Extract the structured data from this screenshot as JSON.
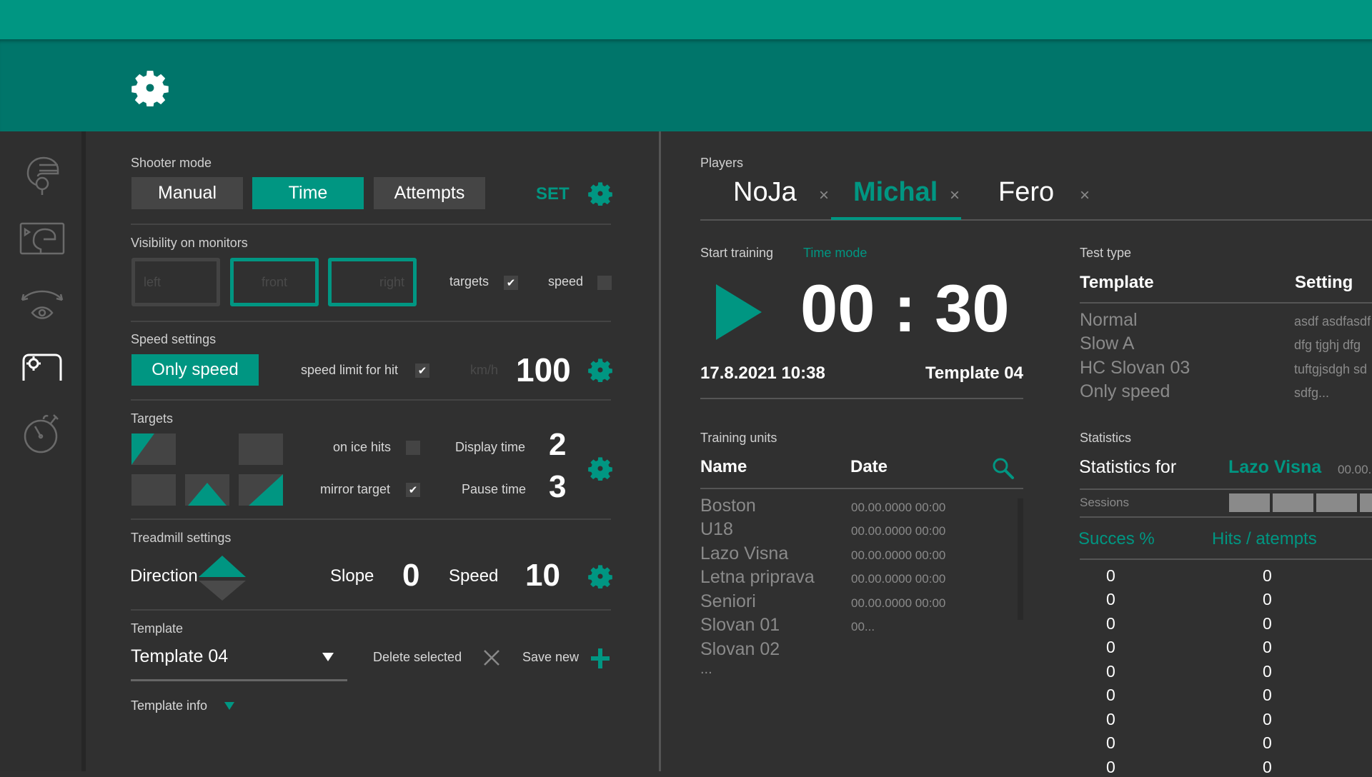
{
  "colors": {
    "accent": "#009682",
    "header": "#00756a",
    "background": "#303030",
    "muted": "#8a8a8a"
  },
  "header": {
    "icon": "gear-icon"
  },
  "sidebar": {
    "items": [
      {
        "icon": "player-helmet-icon",
        "active": false
      },
      {
        "icon": "monitor-player-icon",
        "active": false
      },
      {
        "icon": "view-angle-eye-icon",
        "active": false
      },
      {
        "icon": "goal-target-icon",
        "active": true
      },
      {
        "icon": "stopwatch-icon",
        "active": false
      }
    ]
  },
  "left": {
    "shooter_mode": {
      "label": "Shooter mode",
      "buttons": [
        "Manual",
        "Time",
        "Attempts"
      ],
      "selected": "Time",
      "set_label": "SET"
    },
    "visibility": {
      "label": "Visibility on monitors",
      "monitors": [
        {
          "label": "left",
          "enabled": false
        },
        {
          "label": "front",
          "enabled": true
        },
        {
          "label": "right",
          "enabled": true
        }
      ],
      "targets_label": "targets",
      "targets_checked": true,
      "speed_label": "speed",
      "speed_checked": false
    },
    "speed_settings": {
      "label": "Speed settings",
      "only_speed_label": "Only speed",
      "limit_label": "speed limit for hit",
      "limit_checked": true,
      "unit": "km/h",
      "value": "100"
    },
    "targets": {
      "label": "Targets",
      "on_ice_label": "on ice hits",
      "on_ice_checked": false,
      "mirror_label": "mirror target",
      "mirror_checked": true,
      "display_time_label": "Display time",
      "display_time": "2",
      "pause_time_label": "Pause time",
      "pause_time": "3"
    },
    "treadmill": {
      "label": "Treadmill settings",
      "direction_label": "Direction",
      "direction": "up",
      "slope_label": "Slope",
      "slope": "0",
      "speed_label": "Speed",
      "speed": "10"
    },
    "template": {
      "label": "Template",
      "selected": "Template 04",
      "delete_label": "Delete selected",
      "save_label": "Save new",
      "info_label": "Template info"
    }
  },
  "center": {
    "players_label": "Players",
    "players": [
      {
        "name": "NoJa",
        "active": false
      },
      {
        "name": "Michal",
        "active": true
      },
      {
        "name": "Fero",
        "active": false
      }
    ],
    "start_training_label": "Start training",
    "mode_label": "Time mode",
    "timer": "00 : 30",
    "datetime": "17.8.2021 10:38",
    "template": "Template 04",
    "training_units": {
      "label": "Training units",
      "columns": [
        "Name",
        "Date"
      ],
      "rows": [
        {
          "name": "Boston",
          "date": "00.00.0000 00:00"
        },
        {
          "name": "U18",
          "date": "00.00.0000 00:00"
        },
        {
          "name": "Lazo Visna",
          "date": "00.00.0000 00:00"
        },
        {
          "name": "Letna priprava",
          "date": "00.00.0000 00:00"
        },
        {
          "name": "Seniori",
          "date": "00.00.0000 00:00"
        },
        {
          "name": "Slovan 01",
          "date": "00..."
        },
        {
          "name": "Slovan 02",
          "date": ""
        }
      ],
      "more": "..."
    }
  },
  "right": {
    "test_type": {
      "label": "Test type",
      "columns": [
        "Template",
        "Setting"
      ],
      "rows": [
        {
          "template": "Normal",
          "setting": "asdf  asdfasdf"
        },
        {
          "template": "Slow A",
          "setting": "dfg  tjghj  dfg"
        },
        {
          "template": "HC Slovan 03",
          "setting": "tuftgjsdgh  sd"
        },
        {
          "template": "Only speed",
          "setting": "sdfg..."
        }
      ]
    },
    "statistics": {
      "label": "Statistics",
      "for_label": "Statistics for",
      "for_name": "Lazo Visna",
      "for_date": "00.00.",
      "sessions_label": "Sessions",
      "session_count_visible": 4,
      "columns": [
        "Succes %",
        "Hits / atempts"
      ],
      "rows": [
        [
          "0",
          "0"
        ],
        [
          "0",
          "0"
        ],
        [
          "0",
          "0"
        ],
        [
          "0",
          "0"
        ],
        [
          "0",
          "0"
        ],
        [
          "0",
          "0"
        ],
        [
          "0",
          "0"
        ],
        [
          "0",
          "0"
        ],
        [
          "0",
          "0"
        ]
      ]
    }
  }
}
